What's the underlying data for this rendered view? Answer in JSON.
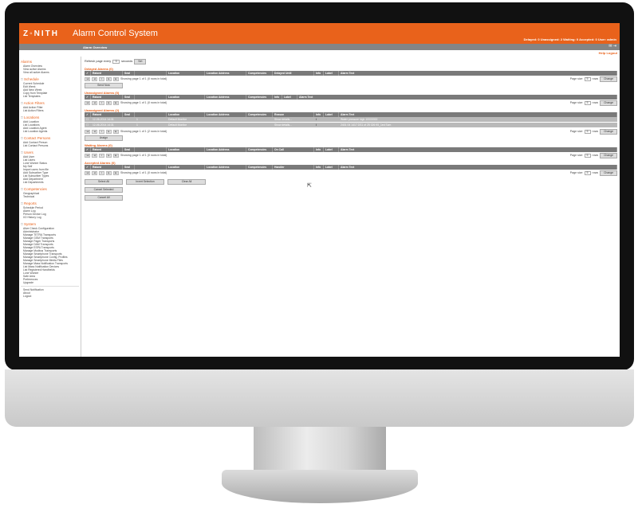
{
  "app": {
    "logo": "Z◦NITH",
    "title": "Alarm Control System",
    "status": "Delayed: 0  Unassigned: 2  Waiting: 0  Accepted: 0   User: admin",
    "page": "Alarm Overview",
    "icons": "✉ ⇥",
    "help": "Help",
    "logout": "Logout"
  },
  "sidebar": [
    {
      "head": "Alarms",
      "boxed": false,
      "items": [
        "Alarm Overview",
        "View active Alarms",
        "View all active Alarms"
      ]
    },
    {
      "head": "Schedule",
      "boxed": true,
      "items": [
        "Current Schedule",
        "Edit Week",
        "Add New Week",
        "Copy from Template",
        "List Templates"
      ]
    },
    {
      "head": "Action Filters",
      "boxed": true,
      "items": [
        "Add Action Filter",
        "List Action Filters"
      ]
    },
    {
      "head": "Locations",
      "boxed": true,
      "items": [
        "Add Location",
        "List Locations",
        "Add Location Agent",
        "List Location Agents"
      ]
    },
    {
      "head": "Contact Persons",
      "boxed": true,
      "items": [
        "Add Contact Person",
        "List Contact Persons"
      ]
    },
    {
      "head": "Users",
      "boxed": true,
      "items": [
        "Add User",
        "List Users",
        "Lone Worker Status",
        "My Self",
        "Import users from file",
        "Add Subscriber Type",
        "List Subscriber Types",
        "Add Department",
        "List Departments"
      ]
    },
    {
      "head": "Competencies",
      "boxed": true,
      "items": [
        "Geographical",
        "Technical"
      ]
    },
    {
      "head": "Reports",
      "boxed": true,
      "items": [
        "Schedule Period",
        "Alarm Log",
        "Person Device Log",
        "I/O History Log"
      ]
    },
    {
      "head": "System",
      "boxed": true,
      "items": [
        "Alive Check Configuration",
        "Administrator",
        "Manage TETRA Transports",
        "Manage GSM Transports",
        "Manage Pager Transports",
        "Manage DAM Transports",
        "Manage ESPA Transports",
        "Manage Modbus Transports",
        "Manage Smartphone Transports",
        "Manage Smartphone Config. Profiles",
        "Manage Smartphone Media Files",
        "Manage Mass Notification Transports",
        "List Mass Notification Devices",
        "List Registered Handhelds",
        "Lone Worker",
        "Safe Area",
        "Preferences",
        "Upgrade"
      ]
    },
    {
      "head": "",
      "boxed": false,
      "sep": true,
      "items": [
        "Send Notification",
        "About",
        "Logout"
      ]
    }
  ],
  "refresh": {
    "prefix": "Refresh page every",
    "value": "0",
    "suffix": "seconds",
    "button": "Set"
  },
  "paging": {
    "page_size_label": "Page size",
    "page_size": "5",
    "rows": "rows",
    "change": "Change"
  },
  "sections": [
    {
      "title": "Delayed Alarms (0)",
      "cols": [
        "Raised",
        "Seal",
        "",
        "Location",
        "Location Address",
        "Competencies",
        "Delayed Until",
        "Info",
        "Label",
        "Alarm Text"
      ],
      "rows": [],
      "pager": "Showing page 1 of 1 (0 rows in total)",
      "action": "Send Now"
    },
    {
      "title": "Unassigned Alarms (0)",
      "cols": [
        "Raised",
        "Seal",
        "",
        "Location",
        "Location Address",
        "Competencies",
        "Info",
        "Label",
        "Alarm Text"
      ],
      "rows": [],
      "pager": "Showing page 1 of 1 (0 rows in total)",
      "action": ""
    },
    {
      "title": "Unassigned Alarms (2)",
      "cols": [
        "Raised",
        "Seal",
        "",
        "Location",
        "Location Address",
        "Competencies",
        "Reason",
        "Info",
        "Label",
        "Alarm Text"
      ],
      "rows": [
        [
          "12-06-2014 14:31",
          "",
          "1",
          "Default Monitor",
          "",
          "",
          "Show details...",
          "i",
          "",
          "Water pressure high 10000000"
        ],
        [
          "12-06-2014 14:31",
          "",
          "1",
          "Default Monitor",
          "",
          "",
          "Show details...",
          "i",
          "",
          "2401 04 1417 DS1 of 25 026 95_1ed Scm"
        ]
      ],
      "pager": "Showing page 1 of 1 (2 rows in total)",
      "action": "Assign"
    },
    {
      "title": "Waiting Alarms (0)",
      "cols": [
        "Raised",
        "Seal",
        "",
        "Location",
        "Location Address",
        "Competencies",
        "On Call",
        "Info",
        "Label",
        "Alarm Text"
      ],
      "rows": [],
      "pager": "Showing page 1 of 1 (0 rows in total)",
      "action": ""
    },
    {
      "title": "Accepted Alarms (0)",
      "cols": [
        "Raised",
        "Seal",
        "",
        "Location",
        "Location Address",
        "Competencies",
        "Handler",
        "Info",
        "Label",
        "Alarm Text"
      ],
      "rows": [],
      "pager": "Showing page 1 of 1 (0 rows in total)",
      "action": ""
    }
  ],
  "bottom": {
    "select_all": "Select All",
    "invert": "Invert Selection",
    "clear_all": "Clear All",
    "cancel_selected": "Cancel Selected",
    "cancel_all": "Cancel All"
  }
}
